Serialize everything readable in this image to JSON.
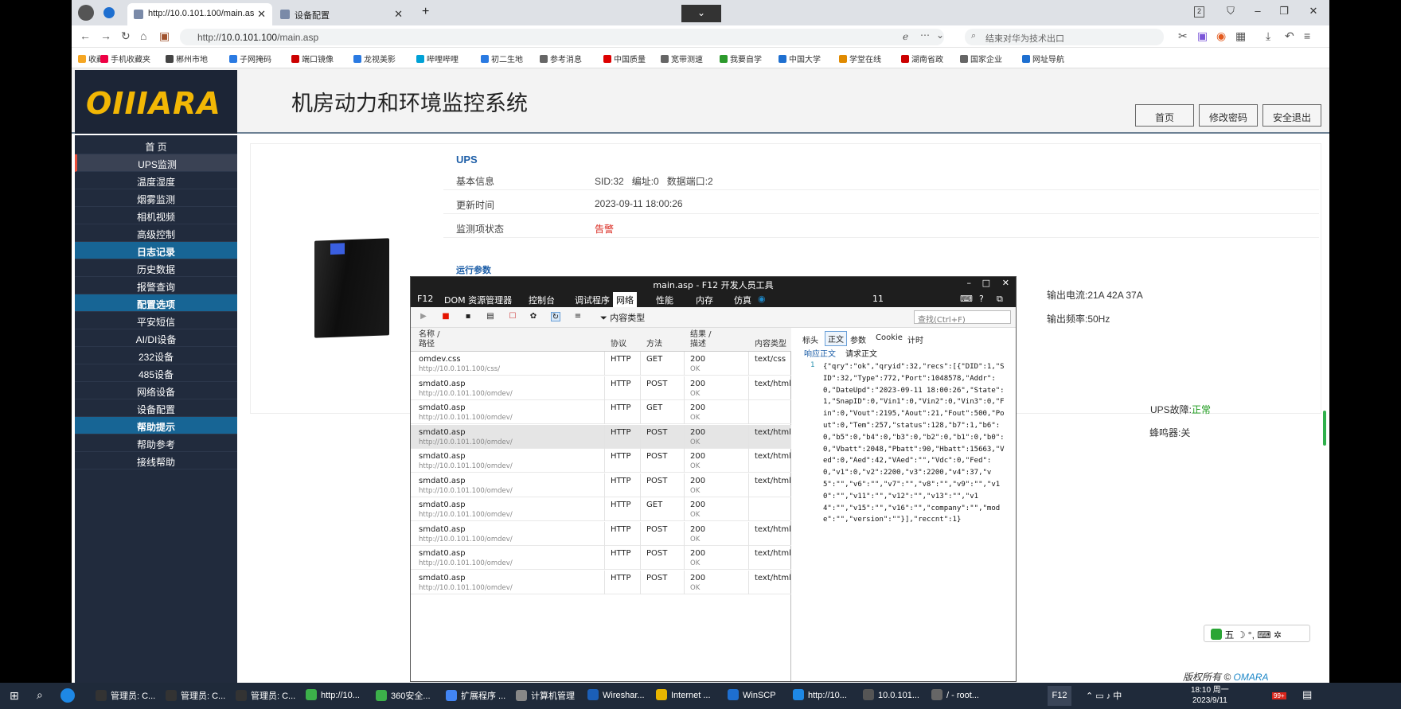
{
  "browser": {
    "tabs": [
      {
        "label": "http://10.0.101.100/main.as"
      },
      {
        "label": "设备配置"
      }
    ],
    "new_tab": "+",
    "url_prefix": "http://",
    "url_host": "10.0.101.100",
    "url_path": "/main.asp",
    "search_placeholder": "结束对华为技术出口",
    "bookmarks": [
      "收藏",
      "手机收藏夹",
      "郴州市地",
      "子网掩码",
      "端口镜像",
      "龙视美影",
      "哔哩哔哩",
      "初二生地",
      "参考消息",
      "中国质量",
      "宽带测速",
      "我要自学",
      "中国大学",
      "学堂在线",
      "湖南省政",
      "国家企业",
      "网址导航"
    ],
    "tab_count": "2"
  },
  "page": {
    "logo": "OIIIARA",
    "title": "机房动力和环境监控系统",
    "top_buttons": [
      "首页",
      "修改密码",
      "安全退出"
    ],
    "nav": [
      {
        "label": "首 页",
        "type": "item"
      },
      {
        "label": "UPS监测",
        "type": "active"
      },
      {
        "label": "温度湿度",
        "type": "item"
      },
      {
        "label": "烟雾监测",
        "type": "item"
      },
      {
        "label": "相机视频",
        "type": "item"
      },
      {
        "label": "高级控制",
        "type": "item"
      },
      {
        "label": "日志记录",
        "type": "hdr"
      },
      {
        "label": "历史数据",
        "type": "item"
      },
      {
        "label": "报警查询",
        "type": "item"
      },
      {
        "label": "配置选项",
        "type": "hdr"
      },
      {
        "label": "平安短信",
        "type": "item"
      },
      {
        "label": "AI/DI设备",
        "type": "item"
      },
      {
        "label": "232设备",
        "type": "item"
      },
      {
        "label": "485设备",
        "type": "item"
      },
      {
        "label": "网络设备",
        "type": "item"
      },
      {
        "label": "设备配置",
        "type": "item"
      },
      {
        "label": "帮助提示",
        "type": "hdr"
      },
      {
        "label": "帮助参考",
        "type": "item"
      },
      {
        "label": "接线帮助",
        "type": "item"
      }
    ],
    "ups": {
      "heading": "UPS",
      "basic_label": "基本信息",
      "basic_value": "SID:32   编址:0   数据端口:2",
      "update_label": "更新时间",
      "update_value": "2023-09-11 18:00:26",
      "status_label": "监测项状态",
      "status_value": "告警",
      "run_heading": "运行参数",
      "out_current": "输出电流:21A 42A 37A",
      "out_freq": "输出频率:50Hz",
      "ups_fault_label": "UPS故障:",
      "ups_fault_value": "正常",
      "buzzer": "蜂鸣器:关"
    },
    "copyright": "版权所有 ©",
    "copyright_brand": "OMARA"
  },
  "devtools": {
    "title": "main.asp - F12 开发人员工具",
    "tabs": [
      "F12",
      "DOM 资源管理器",
      "控制台",
      "调试程序",
      "网络",
      "性能",
      "内存",
      "仿真"
    ],
    "error_count": "11",
    "content_type_filter": "内容类型",
    "find_placeholder": "查找(Ctrl+F)",
    "columns": {
      "name": "名称 /",
      "path": "路径",
      "protocol": "协议",
      "method": "方法",
      "result": "结果 /",
      "desc": "描述",
      "ctype": "内容类型"
    },
    "requests": [
      {
        "name": "omdev.css",
        "path": "http://10.0.101.100/css/",
        "protocol": "HTTP",
        "method": "GET",
        "code": "200",
        "status": "OK",
        "ctype": "text/css"
      },
      {
        "name": "smdat0.asp",
        "path": "http://10.0.101.100/omdev/",
        "protocol": "HTTP",
        "method": "POST",
        "code": "200",
        "status": "OK",
        "ctype": "text/html"
      },
      {
        "name": "smdat0.asp",
        "path": "http://10.0.101.100/omdev/",
        "protocol": "HTTP",
        "method": "GET",
        "code": "200",
        "status": "OK",
        "ctype": ""
      },
      {
        "name": "smdat0.asp",
        "path": "http://10.0.101.100/omdev/",
        "protocol": "HTTP",
        "method": "POST",
        "code": "200",
        "status": "OK",
        "ctype": "text/html"
      },
      {
        "name": "smdat0.asp",
        "path": "http://10.0.101.100/omdev/",
        "protocol": "HTTP",
        "method": "POST",
        "code": "200",
        "status": "OK",
        "ctype": "text/html"
      },
      {
        "name": "smdat0.asp",
        "path": "http://10.0.101.100/omdev/",
        "protocol": "HTTP",
        "method": "POST",
        "code": "200",
        "status": "OK",
        "ctype": "text/html"
      },
      {
        "name": "smdat0.asp",
        "path": "http://10.0.101.100/omdev/",
        "protocol": "HTTP",
        "method": "GET",
        "code": "200",
        "status": "OK",
        "ctype": ""
      },
      {
        "name": "smdat0.asp",
        "path": "http://10.0.101.100/omdev/",
        "protocol": "HTTP",
        "method": "POST",
        "code": "200",
        "status": "OK",
        "ctype": "text/html"
      },
      {
        "name": "smdat0.asp",
        "path": "http://10.0.101.100/omdev/",
        "protocol": "HTTP",
        "method": "POST",
        "code": "200",
        "status": "OK",
        "ctype": "text/html"
      },
      {
        "name": "smdat0.asp",
        "path": "http://10.0.101.100/omdev/",
        "protocol": "HTTP",
        "method": "POST",
        "code": "200",
        "status": "OK",
        "ctype": "text/html"
      }
    ],
    "selected_row": 3,
    "resp_tabs": [
      "标头",
      "正文",
      "参数",
      "Cookie",
      "计时"
    ],
    "sub_tabs": [
      "响应正文",
      "请求正文"
    ],
    "line_no": "1",
    "response_body": "{\"qry\":\"ok\",\"qryid\":32,\"recs\":[{\"DID\":1,\"SID\":32,\"Type\":772,\"Port\":1048578,\"Addr\":0,\"DateUpd\":\"2023-09-11 18:00:26\",\"State\":1,\"SnapID\":0,\"Vin1\":0,\"Vin2\":0,\"Vin3\":0,\"Fin\":0,\"Vout\":2195,\"Aout\":21,\"Fout\":500,\"Pout\":0,\"Tem\":257,\"status\":128,\"b7\":1,\"b6\":0,\"b5\":0,\"b4\":0,\"b3\":0,\"b2\":0,\"b1\":0,\"b0\":0,\"Vbatt\":2048,\"Pbatt\":90,\"Hbatt\":15663,\"Ved\":0,\"Aed\":42,\"VAed\":\"\",\"Vdc\":0,\"Fed\":0,\"v1\":0,\"v2\":2200,\"v3\":2200,\"v4\":37,\"v5\":\"\",\"v6\":\"\",\"v7\":\"\",\"v8\":\"\",\"v9\":\"\",\"v10\":\"\",\"v11\":\"\",\"v12\":\"\",\"v13\":\"\",\"v14\":\"\",\"v15\":\"\",\"v16\":\"\",\"company\":\"\",\"mode\":\"\",\"version\":\"\"}],\"reccnt\":1}"
  },
  "ime": {
    "label": "五"
  },
  "taskbar": {
    "items": [
      "管理员: C...",
      "管理员: C...",
      "管理员: C...",
      "http://10...",
      "360安全...",
      "扩展程序 ...",
      "计算机管理",
      "Wireshar...",
      "Internet ...",
      "WinSCP",
      "http://10...",
      "10.0.101...",
      "/ - root..."
    ],
    "f12": "F12",
    "time": "18:10 周一",
    "date": "2023/9/11",
    "lang": "中",
    "badge": "99+"
  },
  "colors": {
    "sidebar": "#212b3d",
    "nav_header": "#176595",
    "logo": "#f2b705",
    "alarm": "#d9261c",
    "ok": "#1a9a1a",
    "link": "#1e5fa8"
  }
}
